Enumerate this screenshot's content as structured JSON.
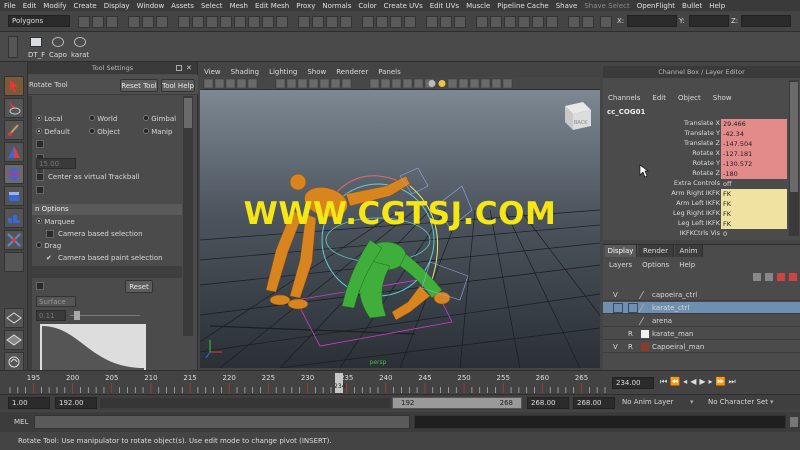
{
  "menu": [
    "File",
    "Edit",
    "Modify",
    "Create",
    "Display",
    "Window",
    "Assets",
    "Select",
    "Mesh",
    "Edit Mesh",
    "Proxy",
    "Normals",
    "Color",
    "Create UVs",
    "Edit UVs",
    "Muscle",
    "Pipeline Cache",
    "Shave",
    "Shave Select",
    "OpenFlight",
    "Bullet",
    "Help"
  ],
  "status_line": {
    "mode": "Polygons",
    "x_label": "X:",
    "y_label": "Y:",
    "z_label": "Z:"
  },
  "shelf": {
    "items": [
      "DT_F",
      "Capo",
      "karat"
    ]
  },
  "tool_settings": {
    "header": "Tool Settings",
    "title": "Rotate Tool",
    "reset_button": "Reset Tool",
    "help_button": "Tool Help",
    "axis_options": [
      "Local",
      "World",
      "Gimbal",
      "Default",
      "Object",
      "Manip"
    ],
    "step_value": "15.00",
    "trackball_label": "Center as virtual Trackball",
    "section_label": "n Options",
    "marquee": "Marquee",
    "camera_selection": "Camera based selection",
    "drag": "Drag",
    "camera_paint_selection": "Camera based paint selection",
    "reset_button2": "Reset",
    "surface_label": "Surface",
    "slider_value": "0.11"
  },
  "viewport": {
    "menu": [
      "View",
      "Shading",
      "Lighting",
      "Show",
      "Renderer",
      "Panels"
    ],
    "cube_label": "BACK",
    "camera_label": "persp",
    "watermark": "WWW.CGTSJ.COM"
  },
  "channel_box": {
    "header": "Channel Box / Layer Editor",
    "menu": [
      "Channels",
      "Edit",
      "Object",
      "Show"
    ],
    "object": "cc_COG01",
    "rows": [
      {
        "label": "Translate X",
        "value": "29.466",
        "color": "#e38a8a"
      },
      {
        "label": "Translate Y",
        "value": "-42.34",
        "color": "#e38a8a"
      },
      {
        "label": "Translate Z",
        "value": "-147.504",
        "color": "#e38a8a"
      },
      {
        "label": "Rotate X",
        "value": "-127.181",
        "color": "#e38a8a"
      },
      {
        "label": "Rotate Y",
        "value": "-130.572",
        "color": "#e38a8a"
      },
      {
        "label": "Rotate Z",
        "value": "-180",
        "color": "#e38a8a"
      },
      {
        "label": "Extra Controls",
        "value": "off",
        "color": ""
      },
      {
        "label": "Arm Right IKFK",
        "value": "FK",
        "color": "#f0e2a0"
      },
      {
        "label": "Arm Left IKFK",
        "value": "FK",
        "color": "#f0e2a0"
      },
      {
        "label": "Leg Right IKFK",
        "value": "FK",
        "color": "#f0e2a0"
      },
      {
        "label": "Leg Left IKFK",
        "value": "FK",
        "color": "#f0e2a0"
      },
      {
        "label": "IKFKCtrls Vis",
        "value": "0",
        "color": ""
      }
    ]
  },
  "layer_editor": {
    "tabs": [
      "Display",
      "Render",
      "Anim"
    ],
    "menu": [
      "Layers",
      "Options",
      "Help"
    ],
    "layers": [
      {
        "v": "V",
        "p": "",
        "name": "capoeira_ctrl",
        "swatch": "",
        "selected": false
      },
      {
        "v": "",
        "p": "",
        "name": "karate_ctrl",
        "swatch": "",
        "selected": true
      },
      {
        "v": "",
        "p": "",
        "name": "arena",
        "swatch": "",
        "selected": false
      },
      {
        "v": "",
        "p": "R",
        "name": "karate_man",
        "swatch": "#f0f0f0",
        "selected": false
      },
      {
        "v": "V",
        "p": "R",
        "name": "Capoeiral_man",
        "swatch": "#8b3b2b",
        "selected": false
      }
    ]
  },
  "timeline": {
    "ticks": [
      "195",
      "200",
      "205",
      "210",
      "215",
      "220",
      "225",
      "230",
      "235",
      "240",
      "245",
      "250",
      "255",
      "260",
      "265"
    ],
    "current_frame_marker": "234",
    "current_frame": "234.00"
  },
  "range": {
    "start": "1.00",
    "range_start": "192.00",
    "slider_start": "192",
    "slider_end": "268",
    "range_end": "268.00",
    "end": "268.00",
    "anim_layer": "No Anim Layer",
    "character_set": "No Character Set"
  },
  "command_line": {
    "label": "MEL"
  },
  "help_line": "Rotate Tool: Use manipulator to rotate object(s). Use edit mode to change pivot (INSERT)."
}
